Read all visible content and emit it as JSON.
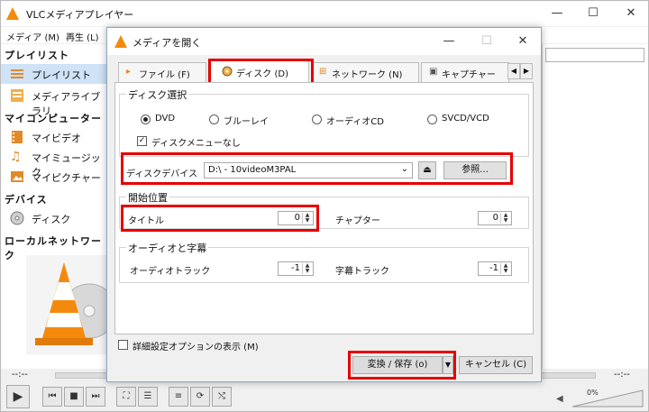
{
  "colors": {
    "highlight_red": "#e60000",
    "vlc_orange": "#f48a0c",
    "selection": "#cfe2f6"
  },
  "vlc": {
    "title": "VLCメディアプレイヤー",
    "menus": [
      "メディア (M)",
      "再生 (L)"
    ],
    "sidebar": {
      "sections": {
        "playlist": "プレイリスト",
        "mycomputer": "マイコンピューター",
        "devices": "デバイス",
        "localnet": "ローカルネットワーク"
      },
      "items": {
        "playlist": "プレイリスト",
        "medialib": "メディアライブラリ",
        "video": "マイビデオ",
        "music": "マイミュージック",
        "pictures": "マイピクチャー",
        "disc": "ディスク"
      }
    },
    "time_left": "--:--",
    "time_right": "--:--",
    "volume": "0%"
  },
  "dialog": {
    "title": "メディアを開く",
    "tabs": [
      "ファイル (F)",
      "ディスク (D)",
      "ネットワーク (N)",
      "キャプチャー"
    ],
    "disc_selection": {
      "group_title": "ディスク選択",
      "options": [
        "DVD",
        "ブルーレイ",
        "オーディオCD",
        "SVCD/VCD"
      ],
      "selected": "DVD",
      "no_menu_label": "ディスクメニューなし",
      "no_menu_checked": true
    },
    "device": {
      "label": "ディスクデバイス",
      "value": "D:\\ - 10videoM3PAL",
      "browse_label": "参照..."
    },
    "start_position": {
      "group_title": "開始位置",
      "title_label": "タイトル",
      "title_value": "0",
      "chapter_label": "チャプター",
      "chapter_value": "0"
    },
    "audio_subs": {
      "group_title": "オーディオと字幕",
      "audio_label": "オーディオトラック",
      "audio_value": "-1",
      "subtitle_label": "字幕トラック",
      "subtitle_value": "-1"
    },
    "advanced_label": "詳細設定オプションの表示 (M)",
    "advanced_checked": false,
    "convert_label": "変換 / 保存 (o)",
    "cancel_label": "キャンセル (C)"
  }
}
